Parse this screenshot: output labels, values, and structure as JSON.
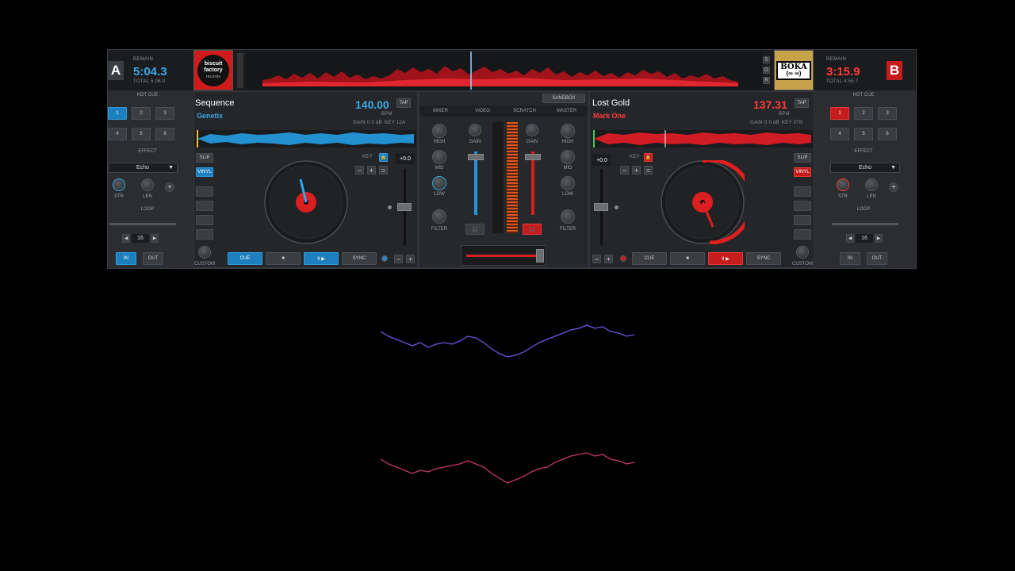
{
  "colors": {
    "deckA": "#3aa8e6",
    "deckB": "#ff3a3a",
    "panel": "#2b2d30"
  },
  "deckA": {
    "letter": "A",
    "remain_label": "REMAIN",
    "time": "5:04.3",
    "total": "TOTAL  5:06.0",
    "logo_lines": [
      "biscuit",
      "factory",
      "records"
    ],
    "title": "Sequence",
    "artist": "Genetix",
    "bpm": "140.00",
    "bpm_label": "BPM",
    "tap": "TAP",
    "gain": "GAIN  0.0 dB",
    "key": "KEY  12A",
    "pitch": "+0.0",
    "key_label": "KEY",
    "slip": "SLIP",
    "vinyl": "VINYL",
    "custom": "CUSTOM",
    "cue": "CUE",
    "stop": "■",
    "play": "II ▶",
    "sync": "SYNC"
  },
  "deckB": {
    "letter": "B",
    "remain_label": "REMAIN",
    "time": "3:15.9",
    "total": "TOTAL  4:55.7",
    "logo_lines": [
      "BOKA",
      "(∞ ∞)"
    ],
    "title": "Lost Gold",
    "artist": "Mark One",
    "bpm": "137.31",
    "bpm_label": "BPM",
    "tap": "TAP",
    "gain": "GAIN  0.0 dB",
    "key": "KEY  07B",
    "pitch": "+0.0",
    "key_label": "KEY",
    "slip": "SLIP",
    "vinyl": "VINYL",
    "custom": "CUSTOM",
    "cue": "CUE",
    "stop": "■",
    "play": "II ▶",
    "sync": "SYNC"
  },
  "side": {
    "hot_cue": "HOT CUE",
    "pads": [
      "1",
      "2",
      "3",
      "4",
      "5",
      "6"
    ],
    "effect": "EFFECT",
    "effect_name": "Echo",
    "str": "STR",
    "len": "LEN",
    "plus": "+",
    "loop": "LOOP",
    "loop_value": "16",
    "in": "IN",
    "out": "OUT"
  },
  "center": {
    "sandbox": "SANDBOX",
    "tabs": [
      "MIXER",
      "VIDEO",
      "SCRATCH",
      "MASTER"
    ],
    "gain": "GAIN",
    "high": "HIGH",
    "mid": "MID",
    "low": "LOW",
    "filter": "FILTER",
    "s_btns": [
      "S",
      "O",
      "R"
    ]
  }
}
